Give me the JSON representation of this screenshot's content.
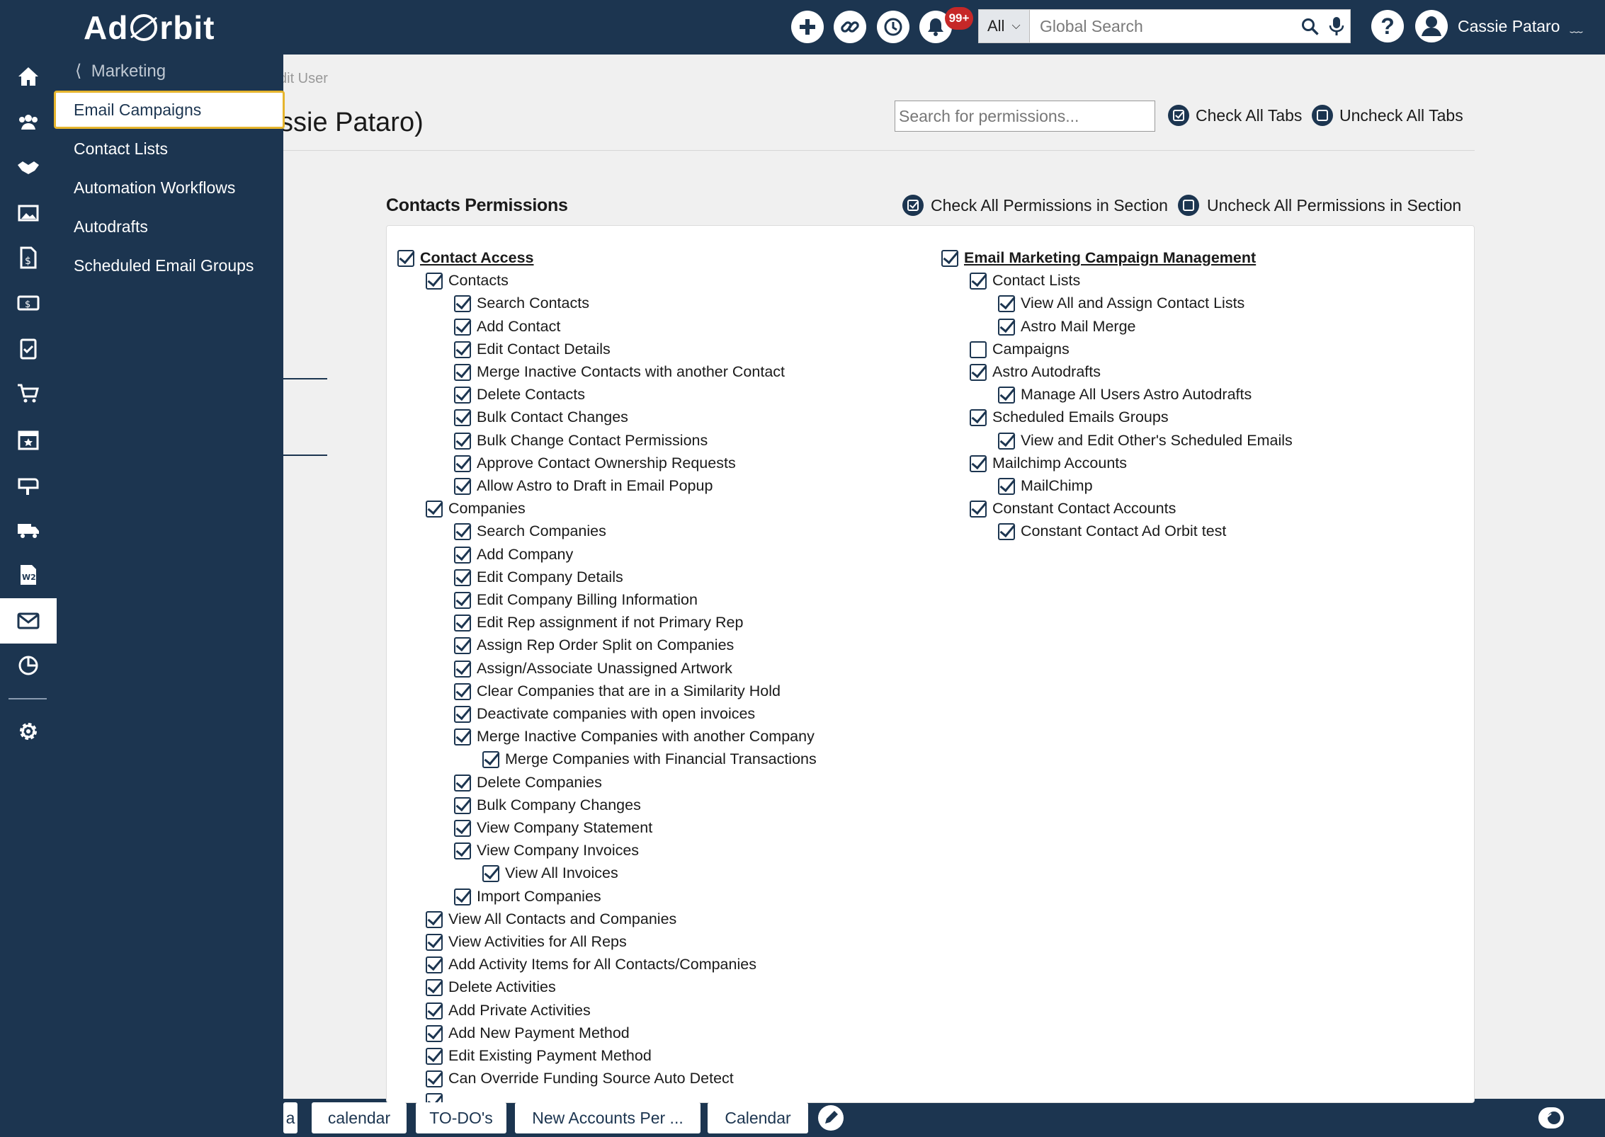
{
  "app": {
    "brand": "AdOrbit",
    "logo_left": "Ad",
    "logo_right": "rbit"
  },
  "topbar": {
    "notification_badge": "99+",
    "search_scope": "All",
    "search_placeholder": "Global Search",
    "help_label": "?",
    "user_name": "Cassie Pataro"
  },
  "rail": {
    "icons": [
      "home-icon",
      "contacts-icon",
      "handshake-icon",
      "media-icon",
      "invoice-icon",
      "payments-icon",
      "clipboard-icon",
      "cart-icon",
      "calendar-icon",
      "mailbox-icon",
      "delivery-truck-icon",
      "w2-icon",
      "email-icon",
      "reports-icon",
      "settings-icon"
    ],
    "active": "email-icon"
  },
  "flyout": {
    "back_label": "Marketing",
    "items": [
      "Email Campaigns",
      "Contact Lists",
      "Automation Workflows",
      "Autodrafts",
      "Scheduled Email Groups"
    ],
    "selected": "Email Campaigns"
  },
  "page": {
    "breadcrumb": "dit User",
    "heading": "ssie Pataro)",
    "permission_search_placeholder": "Search for permissions...",
    "check_all_tabs": "Check All Tabs",
    "uncheck_all_tabs": "Uncheck All Tabs"
  },
  "section": {
    "title": "Contacts Permissions",
    "check_all": "Check All Permissions in Section",
    "uncheck_all": "Uncheck All Permissions in Section",
    "left_column": [
      {
        "label": "Contact Access",
        "level": 0,
        "checked": true,
        "header": true
      },
      {
        "label": "Contacts",
        "level": 1,
        "checked": true
      },
      {
        "label": "Search Contacts",
        "level": 2,
        "checked": true
      },
      {
        "label": "Add Contact",
        "level": 2,
        "checked": true
      },
      {
        "label": "Edit Contact Details",
        "level": 2,
        "checked": true
      },
      {
        "label": "Merge Inactive Contacts with another Contact",
        "level": 2,
        "checked": true
      },
      {
        "label": "Delete Contacts",
        "level": 2,
        "checked": true
      },
      {
        "label": "Bulk Contact Changes",
        "level": 2,
        "checked": true
      },
      {
        "label": "Bulk Change Contact Permissions",
        "level": 2,
        "checked": true
      },
      {
        "label": "Approve Contact Ownership Requests",
        "level": 2,
        "checked": true
      },
      {
        "label": "Allow Astro to Draft in Email Popup",
        "level": 2,
        "checked": true
      },
      {
        "label": "Companies",
        "level": 1,
        "checked": true
      },
      {
        "label": "Search Companies",
        "level": 2,
        "checked": true
      },
      {
        "label": "Add Company",
        "level": 2,
        "checked": true
      },
      {
        "label": "Edit Company Details",
        "level": 2,
        "checked": true
      },
      {
        "label": "Edit Company Billing Information",
        "level": 2,
        "checked": true
      },
      {
        "label": "Edit Rep assignment if not Primary Rep",
        "level": 2,
        "checked": true
      },
      {
        "label": "Assign Rep Order Split on Companies",
        "level": 2,
        "checked": true
      },
      {
        "label": "Assign/Associate Unassigned Artwork",
        "level": 2,
        "checked": true
      },
      {
        "label": "Clear Companies that are in a Similarity Hold",
        "level": 2,
        "checked": true
      },
      {
        "label": "Deactivate companies with open invoices",
        "level": 2,
        "checked": true
      },
      {
        "label": "Merge Inactive Companies with another Company",
        "level": 2,
        "checked": true
      },
      {
        "label": "Merge Companies with Financial Transactions",
        "level": 3,
        "checked": true
      },
      {
        "label": "Delete Companies",
        "level": 2,
        "checked": true
      },
      {
        "label": "Bulk Company Changes",
        "level": 2,
        "checked": true
      },
      {
        "label": "View Company Statement",
        "level": 2,
        "checked": true
      },
      {
        "label": "View Company Invoices",
        "level": 2,
        "checked": true
      },
      {
        "label": "View All Invoices",
        "level": 3,
        "checked": true
      },
      {
        "label": "Import Companies",
        "level": 2,
        "checked": true
      },
      {
        "label": "View All Contacts and Companies",
        "level": 1,
        "checked": true
      },
      {
        "label": "View Activities for All Reps",
        "level": 1,
        "checked": true
      },
      {
        "label": "Add Activity Items for All Contacts/Companies",
        "level": 1,
        "checked": true
      },
      {
        "label": "Delete Activities",
        "level": 1,
        "checked": true
      },
      {
        "label": "Add Private Activities",
        "level": 1,
        "checked": true
      },
      {
        "label": "Add New Payment Method",
        "level": 1,
        "checked": true
      },
      {
        "label": "Edit Existing Payment Method",
        "level": 1,
        "checked": true
      },
      {
        "label": "Can Override Funding Source Auto Detect",
        "level": 1,
        "checked": true
      },
      {
        "label": "",
        "level": 1,
        "checked": true
      }
    ],
    "right_column": [
      {
        "label": "Email Marketing Campaign Management",
        "level": 0,
        "checked": true,
        "header": true
      },
      {
        "label": "Contact Lists",
        "level": 1,
        "checked": true
      },
      {
        "label": "View All and Assign Contact Lists",
        "level": 2,
        "checked": true
      },
      {
        "label": "Astro Mail Merge",
        "level": 2,
        "checked": true
      },
      {
        "label": "Campaigns",
        "level": 1,
        "checked": false
      },
      {
        "label": "Astro Autodrafts",
        "level": 1,
        "checked": true
      },
      {
        "label": "Manage All Users Astro Autodrafts",
        "level": 2,
        "checked": true
      },
      {
        "label": "Scheduled Emails Groups",
        "level": 1,
        "checked": true
      },
      {
        "label": "View and Edit Other's Scheduled Emails",
        "level": 2,
        "checked": true
      },
      {
        "label": "Mailchimp Accounts",
        "level": 1,
        "checked": true
      },
      {
        "label": "MailChimp",
        "level": 2,
        "checked": true
      },
      {
        "label": "Constant Contact Accounts",
        "level": 1,
        "checked": true
      },
      {
        "label": "Constant Contact Ad Orbit test",
        "level": 2,
        "checked": true
      }
    ]
  },
  "bottom_tabs": [
    "a",
    "calendar",
    "TO-DO's",
    "New Accounts Per ...",
    "Calendar"
  ]
}
